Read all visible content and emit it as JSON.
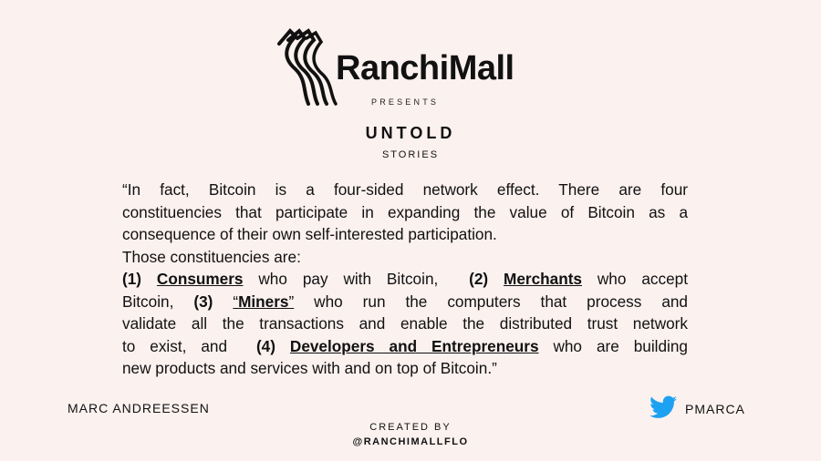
{
  "brand": {
    "name": "RanchiMall",
    "presents": "PRESENTS"
  },
  "header": {
    "title": "UNTOLD",
    "subtitle": "STORIES"
  },
  "quote": {
    "line1": "“In fact, Bitcoin is a four-sided network effect. There are four",
    "line2": "constituencies that participate in expanding the value of Bitcoin as a",
    "line3": "consequence of their own self-interested participation.",
    "line4": "Those constituencies are:",
    "item1_num": "(1)",
    "item1_term": "Consumers",
    "item1_rest": " who pay with Bitcoin,",
    "item2_num": "(2)",
    "item2_term": "Merchants",
    "item2_rest": " who accept",
    "line6_start": "Bitcoin, ",
    "item3_num": "(3)",
    "item3_open": "“",
    "item3_term": "Miners",
    "item3_close": "”",
    "item3_rest": " who run the computers that process and",
    "line7": "validate all the transactions and enable the distributed trust network",
    "line8_start": "to exist, and ",
    "item4_num": "(4)",
    "item4_term": "Developers and Entrepreneurs",
    "item4_rest": " who are building",
    "line9": "new products and services with and on top of Bitcoin.”"
  },
  "author": "MARC ANDREESSEN",
  "twitter": {
    "icon": "twitter-bird-icon",
    "handle": "PMARCA",
    "color": "#1da1f2"
  },
  "footer": {
    "created_by": "CREATED BY",
    "handle": "@RANCHIMALLFLO"
  },
  "colors": {
    "background": "#fbf1ef",
    "text": "#111111"
  }
}
